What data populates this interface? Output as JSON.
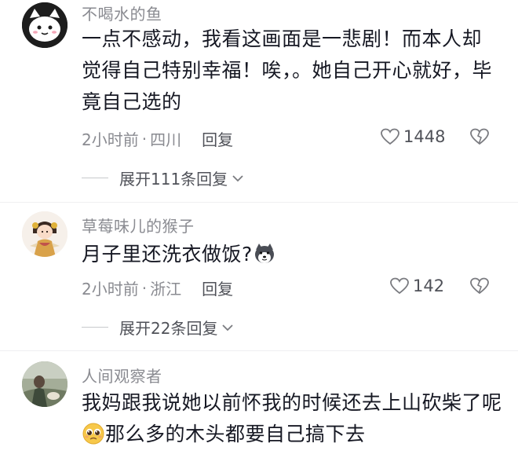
{
  "comments": [
    {
      "username": "不喝水的鱼",
      "content": "一点不感动，我看这画面是一悲剧！而本人却觉得自己特别幸福！唉，。她自己开心就好，毕竟自己选的",
      "time": "2小时前",
      "location": "四川",
      "reply_label": "回复",
      "likes": "1448",
      "expand_label": "展开111条回复"
    },
    {
      "username": "草莓味儿的猴子",
      "content": "月子里还洗衣做饭?",
      "time": "2小时前",
      "location": "浙江",
      "reply_label": "回复",
      "likes": "142",
      "expand_label": "展开22条回复"
    },
    {
      "username": "人间观察者",
      "content_line1": "我妈跟我说她以前怀我的时候还去上山砍柴了呢",
      "content_line2": "那么多的木头都要自己搞下去"
    }
  ],
  "separator": "·",
  "colors": {
    "username": "#8a8b91",
    "text": "#161823",
    "meta": "#8a8b91"
  },
  "icons": [
    "heart-outline-icon",
    "broken-heart-icon",
    "chevron-down-icon",
    "husky-emoji-icon",
    "pleading-emoji-icon"
  ]
}
